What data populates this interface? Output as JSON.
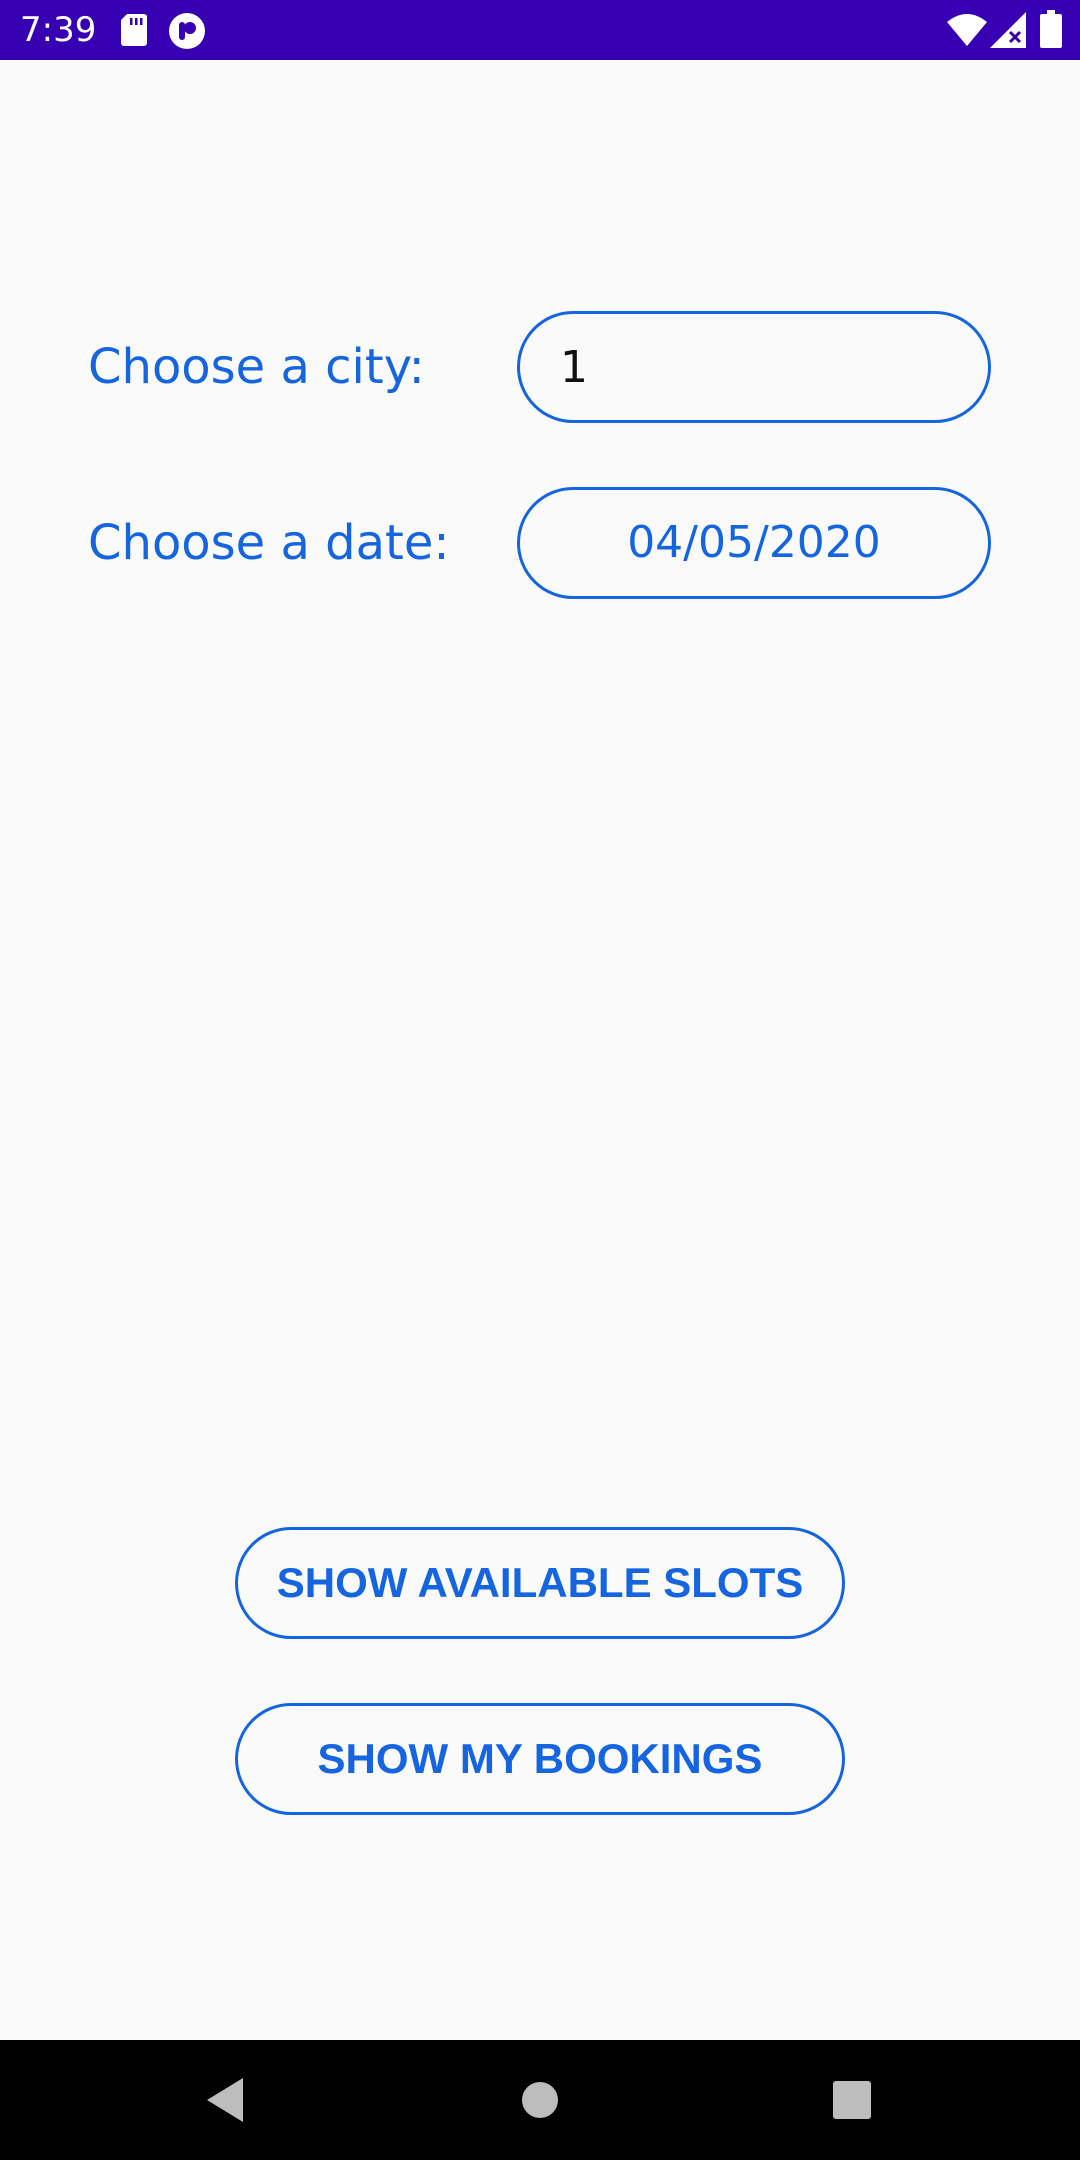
{
  "status_bar": {
    "time": "7:39",
    "icons": [
      "sd-card-icon",
      "app-notification-icon",
      "wifi-icon",
      "signal-icon",
      "battery-icon"
    ],
    "background": "#3700b3"
  },
  "form": {
    "city": {
      "label": "Choose a city:",
      "value": "1"
    },
    "date": {
      "label": "Choose a date:",
      "value": "04/05/2020"
    }
  },
  "buttons": {
    "show_slots": "SHOW AVAILABLE SLOTS",
    "show_bookings": "SHOW MY BOOKINGS"
  },
  "nav_bar": {
    "icons": [
      "back-icon",
      "home-icon",
      "recents-icon"
    ]
  },
  "colors": {
    "accent": "#1565e0",
    "background": "#fafafa",
    "status_bar": "#3700b3",
    "nav_bar": "#000000"
  }
}
